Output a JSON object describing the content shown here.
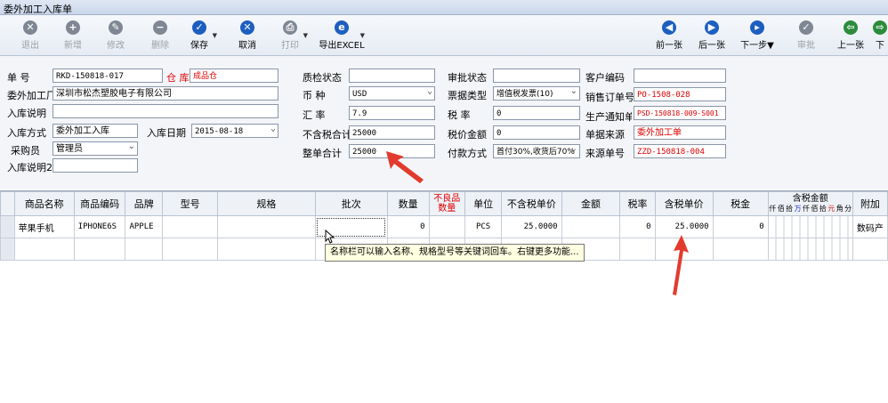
{
  "window": {
    "title": "委外加工入库单"
  },
  "toolbar": {
    "exit": "退出",
    "new": "新增",
    "edit": "修改",
    "delete": "删除",
    "save": "保存",
    "cancel": "取消",
    "print": "打印",
    "export": "导出EXCEL",
    "prev": "前一张",
    "next": "后一张",
    "next_step": "下一步▼",
    "approve": "审批",
    "prev_doc": "上一张",
    "next_doc": "下"
  },
  "form": {
    "doc_no": {
      "label": "单    号",
      "value": "RKD-150818-017"
    },
    "warehouse": {
      "label": "仓 库",
      "value": "成品仓"
    },
    "processor": {
      "label": "委外加工厂",
      "value": "深圳市松杰塑胶电子有限公司"
    },
    "note1": {
      "label": "入库说明",
      "value": ""
    },
    "method": {
      "label": "入库方式",
      "value": "委外加工入库"
    },
    "date": {
      "label": "入库日期",
      "value": "2015-08-18"
    },
    "buyer": {
      "label": "采购员",
      "value": "管理员"
    },
    "note2": {
      "label": "入库说明2",
      "value": ""
    },
    "qc_status": {
      "label": "质检状态",
      "value": ""
    },
    "currency": {
      "label": "币    种",
      "value": "USD"
    },
    "rate": {
      "label": "汇    率",
      "value": "7.9"
    },
    "untaxed_total": {
      "label": "不含税合计",
      "value": "25000"
    },
    "total": {
      "label": "整单合计",
      "value": "25000"
    },
    "approval_status": {
      "label": "审批状态",
      "value": ""
    },
    "invoice_type": {
      "label": "票据类型",
      "value": "增值税发票(10)"
    },
    "tax_rate": {
      "label": "税    率",
      "value": "0"
    },
    "tax_amount": {
      "label": "税价金额",
      "value": "0"
    },
    "payment": {
      "label": "付款方式",
      "value": "首付30%,收货后70%"
    },
    "customer_code": {
      "label": "客户编码",
      "value": ""
    },
    "sales_order": {
      "label": "销售订单号",
      "value": "PO-1508-028"
    },
    "production_notice": {
      "label": "生产通知单号",
      "value": "PSD-150818-009-S001"
    },
    "source": {
      "label": "单据来源",
      "value": "委外加工单"
    },
    "source_no": {
      "label": "来源单号",
      "value": "ZZD-150818-004"
    }
  },
  "grid": {
    "columns": [
      "商品名称",
      "商品编码",
      "品牌",
      "型号",
      "规格",
      "批次",
      "数量",
      "不良品数量",
      "单位",
      "不含税单价",
      "金额",
      "税率",
      "含税单价",
      "税金",
      "含税金额",
      "附加"
    ],
    "amount_subcols": [
      "仟",
      "佰",
      "拾",
      "万",
      "仟",
      "佰",
      "拾",
      "元",
      "角",
      "分"
    ],
    "row": {
      "name": "苹果手机",
      "code": "IPHONE6S",
      "brand": "APPLE",
      "model": "",
      "spec": "",
      "batch": "",
      "qty": "0",
      "defect": "",
      "unit": "PCS",
      "price": "25.0000",
      "amount": "",
      "tax_rate": "0",
      "tax_price": "25.0000",
      "tax": "0",
      "extra": "数码产"
    }
  },
  "tooltip": "名称栏可以输入名称、规格型号等关键词回车。右键更多功能..."
}
